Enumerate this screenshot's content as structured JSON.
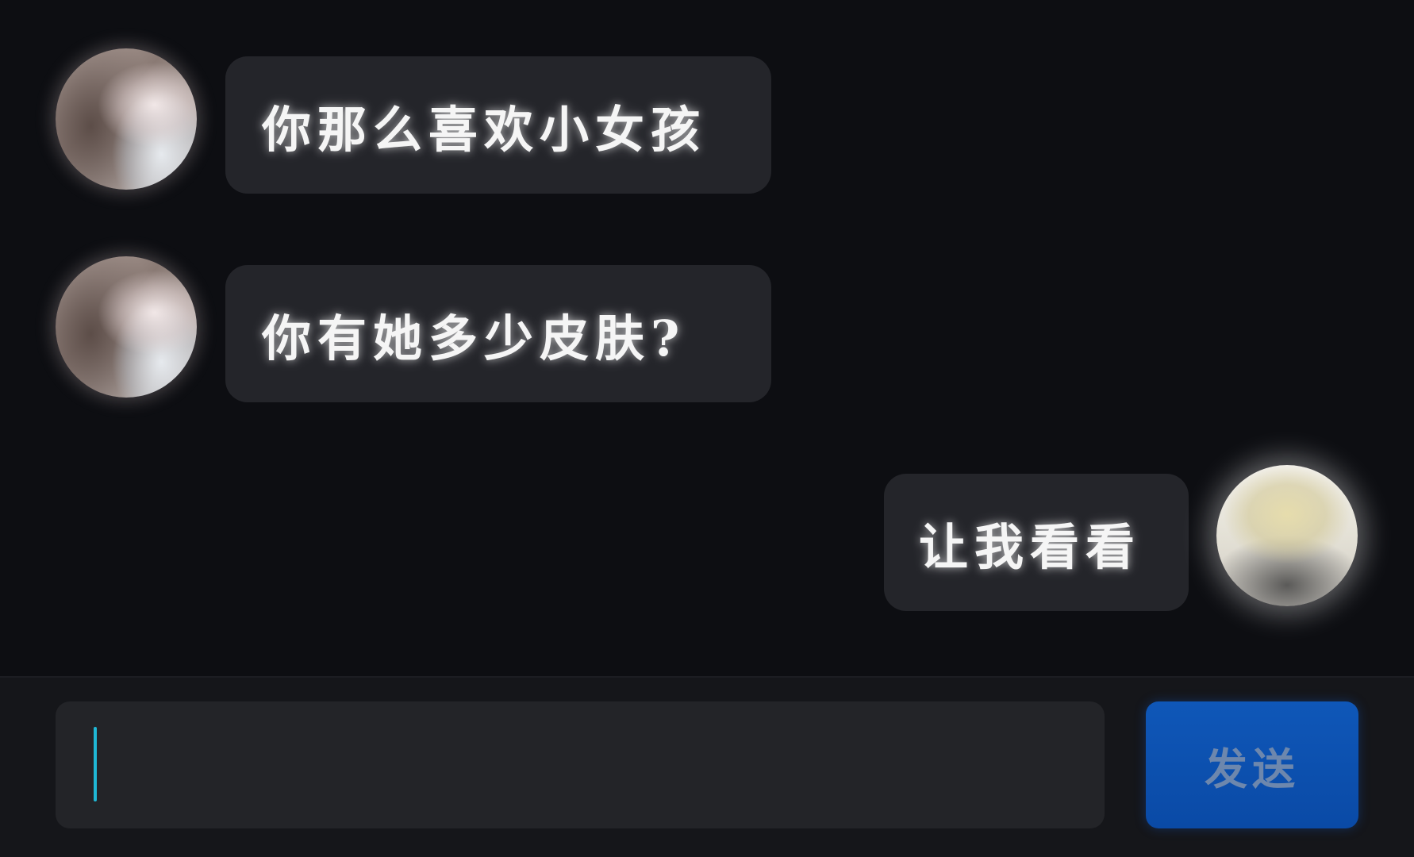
{
  "messages": [
    {
      "side": "left",
      "sender_avatar": "girl-photo-avatar",
      "text": "你那么喜欢小女孩"
    },
    {
      "side": "left",
      "sender_avatar": "girl-photo-avatar",
      "text": "你有她多少皮肤?"
    },
    {
      "side": "right",
      "sender_avatar": "anime-blonde-avatar",
      "text": "让我看看"
    }
  ],
  "composer": {
    "input_value": "",
    "send_label": "发送"
  },
  "colors": {
    "background": "#0d0e12",
    "bubble": "#24252a",
    "input": "#232428",
    "send_button": "#0f57b8",
    "caret": "#1fb8d6"
  }
}
